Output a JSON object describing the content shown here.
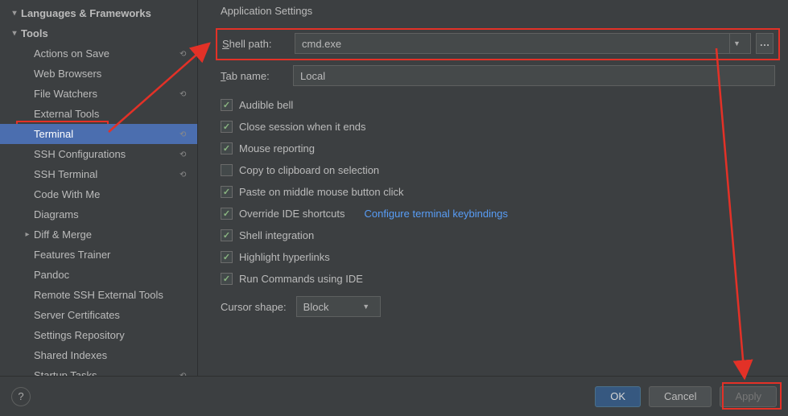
{
  "sidebar": {
    "groups": [
      {
        "label": "Languages & Frameworks",
        "expanded": true
      },
      {
        "label": "Tools",
        "expanded": true
      }
    ],
    "tools_items": [
      {
        "label": "Actions on Save",
        "reset": true
      },
      {
        "label": "Web Browsers"
      },
      {
        "label": "File Watchers",
        "reset": true
      },
      {
        "label": "External Tools"
      },
      {
        "label": "Terminal",
        "selected": true,
        "reset": true
      },
      {
        "label": "SSH Configurations",
        "reset": true
      },
      {
        "label": "SSH Terminal",
        "reset": true
      },
      {
        "label": "Code With Me"
      },
      {
        "label": "Diagrams"
      },
      {
        "label": "Diff & Merge",
        "expandable": true
      },
      {
        "label": "Features Trainer"
      },
      {
        "label": "Pandoc"
      },
      {
        "label": "Remote SSH External Tools"
      },
      {
        "label": "Server Certificates"
      },
      {
        "label": "Settings Repository"
      },
      {
        "label": "Shared Indexes"
      },
      {
        "label": "Startup Tasks",
        "reset": true
      }
    ]
  },
  "section_title": "Application Settings",
  "shell_path_label": "Shell path:",
  "shell_path_value": "cmd.exe",
  "tab_name_label": "Tab name:",
  "tab_name_value": "Local",
  "checks": {
    "audible_bell": {
      "label": "Audible bell",
      "checked": true
    },
    "close_session": {
      "label": "Close session when it ends",
      "checked": true
    },
    "mouse_reporting": {
      "label": "Mouse reporting",
      "checked": true
    },
    "copy_clipboard": {
      "label": "Copy to clipboard on selection",
      "checked": false
    },
    "paste_middle": {
      "label": "Paste on middle mouse button click",
      "checked": true
    },
    "override_ide": {
      "label": "Override IDE shortcuts",
      "checked": true
    },
    "shell_integration": {
      "label": "Shell integration",
      "checked": true
    },
    "highlight_hyperlinks": {
      "label": "Highlight hyperlinks",
      "checked": true
    },
    "run_commands_ide": {
      "label": "Run Commands using IDE",
      "checked": true
    }
  },
  "configure_keybindings": "Configure terminal keybindings",
  "cursor_shape_label": "Cursor shape:",
  "cursor_shape_value": "Block",
  "footer": {
    "ok": "OK",
    "cancel": "Cancel",
    "apply": "Apply"
  }
}
